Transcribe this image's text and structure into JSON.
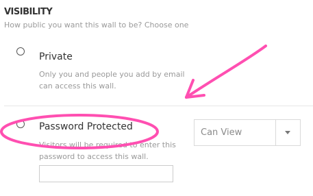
{
  "visibility": {
    "heading": "VISIBILITY",
    "subtitle": "How public you want this wall to be? Choose one"
  },
  "options": [
    {
      "title": "Private",
      "description": "Only you and people you add by email can access this wall.",
      "selected": false
    },
    {
      "title": "Password Protected",
      "description": "Visitors will be required to enter this password to access this wall.",
      "selected": false,
      "password_value": "",
      "password_placeholder": ""
    }
  ],
  "permission_select": {
    "value": "Can View"
  },
  "annotation": {
    "color": "#ff4fb1",
    "arrow_icon": "arrow-annotation",
    "highlight_icon": "ellipse-highlight"
  },
  "colors": {
    "heading": "#333333",
    "muted_text": "#999999",
    "border": "#d9d9d9"
  }
}
